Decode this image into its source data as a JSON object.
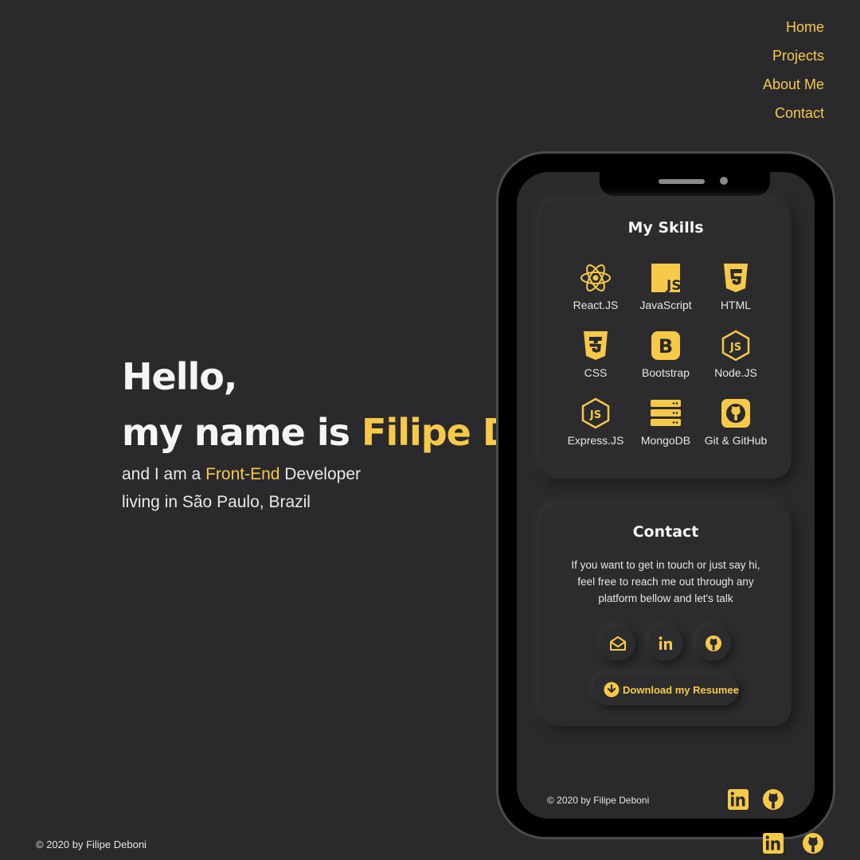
{
  "nav": {
    "items": [
      {
        "label": "Home"
      },
      {
        "label": "Projects"
      },
      {
        "label": "About Me"
      },
      {
        "label": "Contact"
      }
    ]
  },
  "hero": {
    "greeting": "Hello,",
    "name_prefix": "my name is ",
    "name": "Filipe Deboni",
    "line1_prefix": "and I am a ",
    "line1_accent": "Front-End",
    "line1_suffix": " Developer",
    "line2": "living in São Paulo, Brazil"
  },
  "skills": {
    "title": "My Skills",
    "items": [
      {
        "label": "React.JS",
        "icon": "react-icon"
      },
      {
        "label": "JavaScript",
        "icon": "javascript-icon"
      },
      {
        "label": "HTML",
        "icon": "html5-icon"
      },
      {
        "label": "CSS",
        "icon": "css3-icon"
      },
      {
        "label": "Bootstrap",
        "icon": "bootstrap-icon"
      },
      {
        "label": "Node.JS",
        "icon": "nodejs-icon"
      },
      {
        "label": "Express.JS",
        "icon": "nodejs-icon"
      },
      {
        "label": "MongoDB",
        "icon": "server-icon"
      },
      {
        "label": "Git & GitHub",
        "icon": "github-icon"
      }
    ]
  },
  "contact": {
    "title": "Contact",
    "text": "If you want to get in touch or just say hi, feel free to reach me out through any platform bellow and let's talk",
    "social": [
      "email-icon",
      "linkedin-icon",
      "github-icon"
    ],
    "resume_label": "Download my Resumee"
  },
  "footer": {
    "copyright": "© 2020 by Filipe Deboni"
  },
  "colors": {
    "background": "#2a2a2c",
    "accent": "#f7c948",
    "text": "#ffffff"
  }
}
